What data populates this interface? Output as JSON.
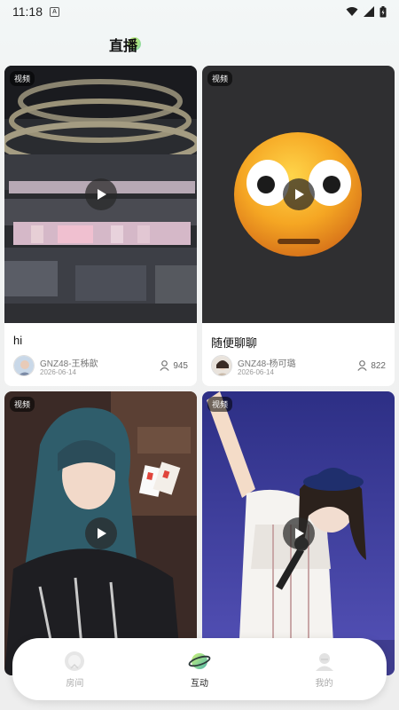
{
  "status_bar": {
    "time": "11:18",
    "notif_letter": "A"
  },
  "header": {
    "title": "直播"
  },
  "cards": [
    {
      "badge": "视频",
      "title": "hi",
      "author": "GNZ48-王秭歆",
      "date": "2026-06-14",
      "viewers": "945"
    },
    {
      "badge": "视频",
      "title": "随便聊聊",
      "author": "GNZ48-杨可璐",
      "date": "2026-06-14",
      "viewers": "822"
    },
    {
      "badge": "视频"
    },
    {
      "badge": "视频"
    }
  ],
  "nav": [
    {
      "label": "房间",
      "icon": "room-icon",
      "active": false
    },
    {
      "label": "互动",
      "icon": "planet-icon",
      "active": true
    },
    {
      "label": "我的",
      "icon": "profile-icon",
      "active": false
    }
  ],
  "colors": {
    "accent": "#8fe06a",
    "card_bg": "#ffffff",
    "page_bg": "#f1f3f3"
  }
}
